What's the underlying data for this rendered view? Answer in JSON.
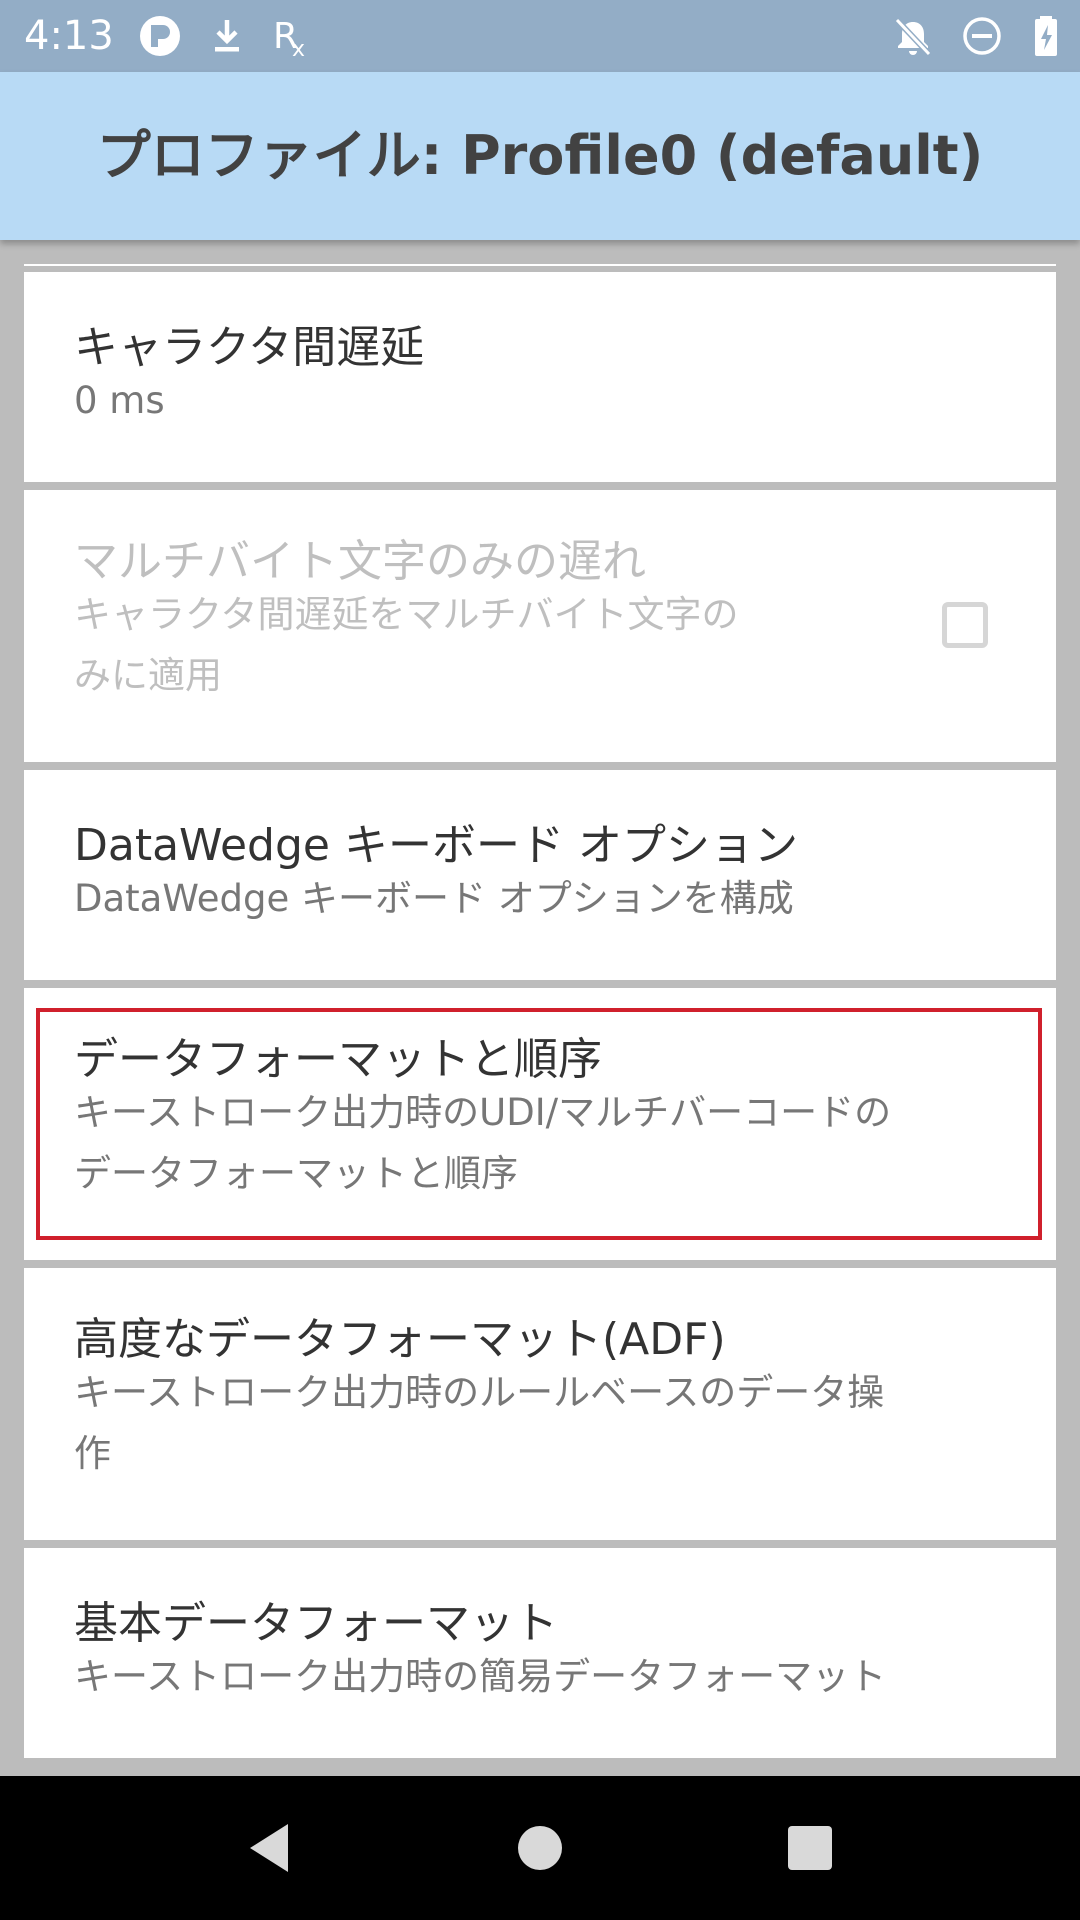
{
  "status_bar": {
    "time": "4:13",
    "left_icons": [
      "r-app-icon",
      "download-icon",
      "rx-icon"
    ],
    "right_icons": [
      "notifications-off-icon",
      "do-not-disturb-icon",
      "battery-charging-icon"
    ],
    "color": "#93adc6"
  },
  "app_bar": {
    "title": "プロファイル: Profile0 (default)",
    "color": "#b8daf5"
  },
  "settings": [
    {
      "title": "キャラクタ間遅延",
      "summary": [
        "0 ms"
      ]
    },
    {
      "title": "マルチバイト文字のみの遅れ",
      "summary": [
        "キャラクタ間遅延をマルチバイト文字の",
        "みに適用"
      ],
      "checkbox_checked": false,
      "enabled": false
    },
    {
      "title": "DataWedge キーボード オプション",
      "summary": [
        "DataWedge キーボード オプションを構成"
      ]
    },
    {
      "title": "データフォーマットと順序",
      "summary": [
        "キーストローク出力時のUDI/マルチバーコードの",
        "データフォーマットと順序"
      ],
      "highlighted": true
    },
    {
      "title": "高度なデータフォーマット(ADF)",
      "summary": [
        "キーストローク出力時のルールベースのデータ操",
        "作"
      ]
    },
    {
      "title": "基本データフォーマット",
      "summary": [
        "キーストローク出力時の簡易データフォーマット"
      ]
    }
  ],
  "highlight_color": "#d0202c",
  "nav_bar": {
    "buttons": [
      "back-icon",
      "home-icon",
      "recents-icon"
    ]
  }
}
